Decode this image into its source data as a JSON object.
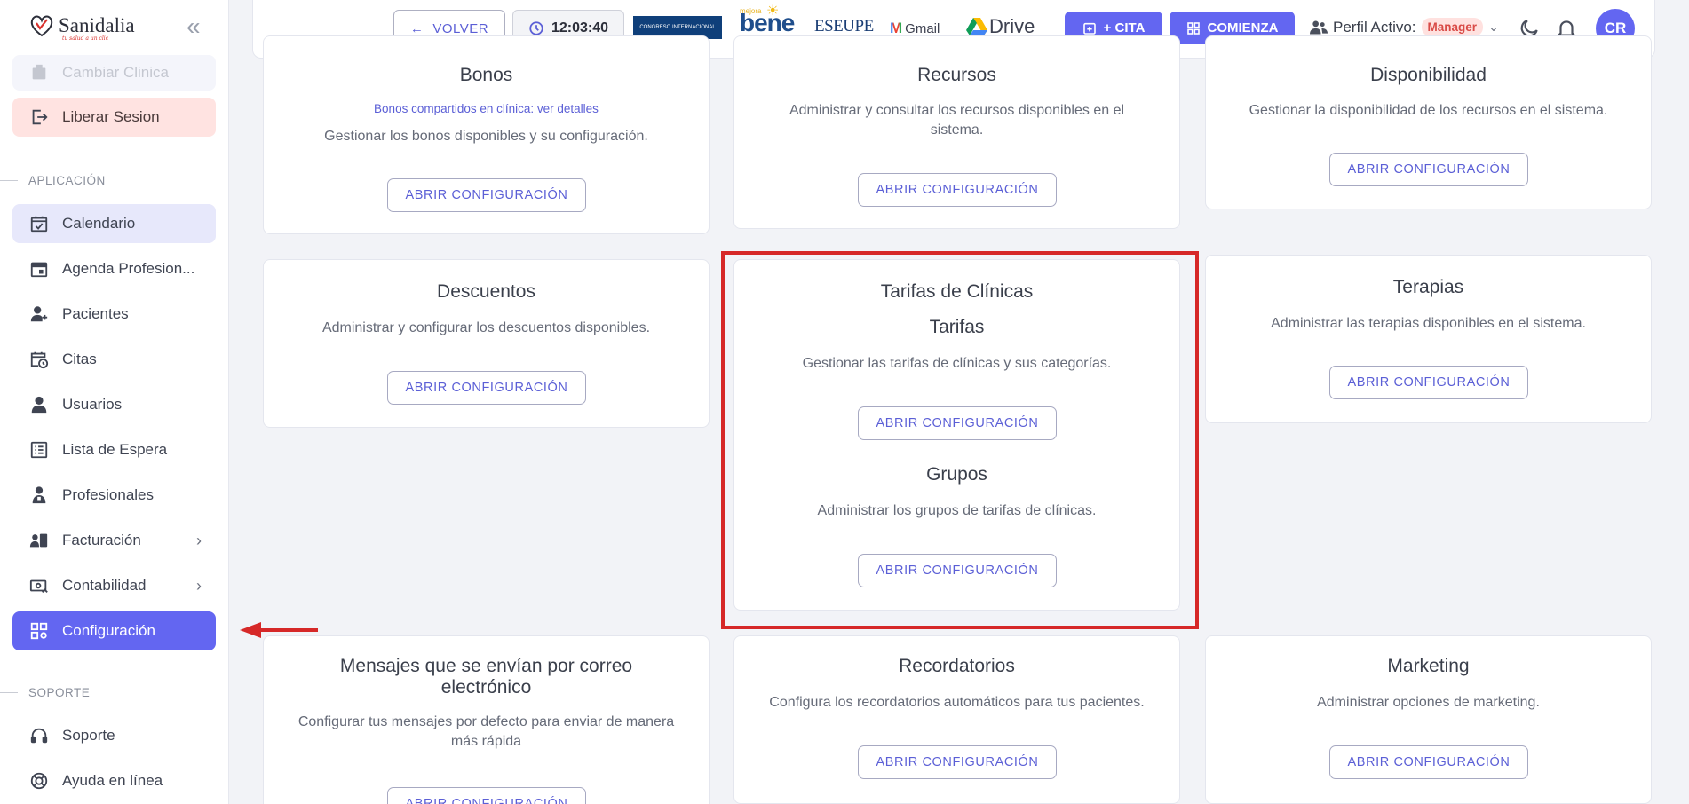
{
  "brand": {
    "name": "Sanidalia",
    "tagline": "tu salud a un clic"
  },
  "sidebar": {
    "top_items": [
      {
        "label": "Cambiar Clinica",
        "icon": "clinic-switch-icon"
      },
      {
        "label": "Liberar Sesion",
        "icon": "logout-icon"
      }
    ],
    "sections": [
      {
        "title": "APLICACIÓN"
      },
      {
        "title": "SOPORTE"
      }
    ],
    "items": [
      {
        "label": "Calendario",
        "icon": "calendar-check-icon"
      },
      {
        "label": "Agenda Profesion...",
        "icon": "calendar-icon"
      },
      {
        "label": "Pacientes",
        "icon": "patient-icon"
      },
      {
        "label": "Citas",
        "icon": "calendar-clock-icon"
      },
      {
        "label": "Usuarios",
        "icon": "user-icon"
      },
      {
        "label": "Lista de Espera",
        "icon": "list-icon"
      },
      {
        "label": "Profesionales",
        "icon": "doctor-icon"
      },
      {
        "label": "Facturación",
        "icon": "billing-icon"
      },
      {
        "label": "Contabilidad",
        "icon": "accounting-icon"
      },
      {
        "label": "Configuración",
        "icon": "settings-grid-icon"
      }
    ],
    "support_items": [
      {
        "label": "Soporte",
        "icon": "headset-icon"
      },
      {
        "label": "Ayuda en línea",
        "icon": "lifebuoy-icon"
      }
    ]
  },
  "topbar": {
    "back_label": "VOLVER",
    "clock": "12:03:40",
    "partners": {
      "congreso": "CONGRESO INTERNACIONAL",
      "bene": "bene",
      "bene_small": "mejora",
      "eseupe": "ESEUPE",
      "gmail": "Gmail",
      "drive": "Drive"
    },
    "cita_label": "+ CITA",
    "comienza_label": "COMIENZA",
    "profile_label": "Perfil Activo:",
    "profile_role": "Manager",
    "avatar_initials": "CR"
  },
  "cards": {
    "bonos": {
      "title": "Bonos",
      "link": "Bonos compartidos en clínica: ver detalles",
      "desc": "Gestionar los bonos disponibles y su configuración.",
      "button": "ABRIR CONFIGURACIÓN"
    },
    "recursos": {
      "title": "Recursos",
      "desc": "Administrar y consultar los recursos disponibles en el sistema.",
      "button": "ABRIR CONFIGURACIÓN"
    },
    "disponibilidad": {
      "title": "Disponibilidad",
      "desc": "Gestionar la disponibilidad de los recursos en el sistema.",
      "button": "ABRIR CONFIGURACIÓN"
    },
    "descuentos": {
      "title": "Descuentos",
      "desc": "Administrar y configurar los descuentos disponibles.",
      "button": "ABRIR CONFIGURACIÓN"
    },
    "tarifas": {
      "title": "Tarifas de Clínicas",
      "sub1_title": "Tarifas",
      "sub1_desc": "Gestionar las tarifas de clínicas y sus categorías.",
      "sub1_button": "ABRIR CONFIGURACIÓN",
      "sub2_title": "Grupos",
      "sub2_desc": "Administrar los grupos de tarifas de clínicas.",
      "sub2_button": "ABRIR CONFIGURACIÓN"
    },
    "terapias": {
      "title": "Terapias",
      "desc": "Administrar las terapias disponibles en el sistema.",
      "button": "ABRIR CONFIGURACIÓN"
    },
    "mensajes": {
      "title": "Mensajes que se envían por correo electrónico",
      "desc": "Configurar tus mensajes por defecto para enviar de manera más rápida",
      "button": "ABRIR CONFIGURACIÓN"
    },
    "recordatorios": {
      "title": "Recordatorios",
      "desc": "Configura los recordatorios automáticos para tus pacientes.",
      "button": "ABRIR CONFIGURACIÓN"
    },
    "marketing": {
      "title": "Marketing",
      "desc": "Administrar opciones de marketing.",
      "button": "ABRIR CONFIGURACIÓN"
    }
  },
  "colors": {
    "accent": "#6366f1",
    "highlight": "#d62828",
    "danger_bg": "#ffe3e1"
  }
}
